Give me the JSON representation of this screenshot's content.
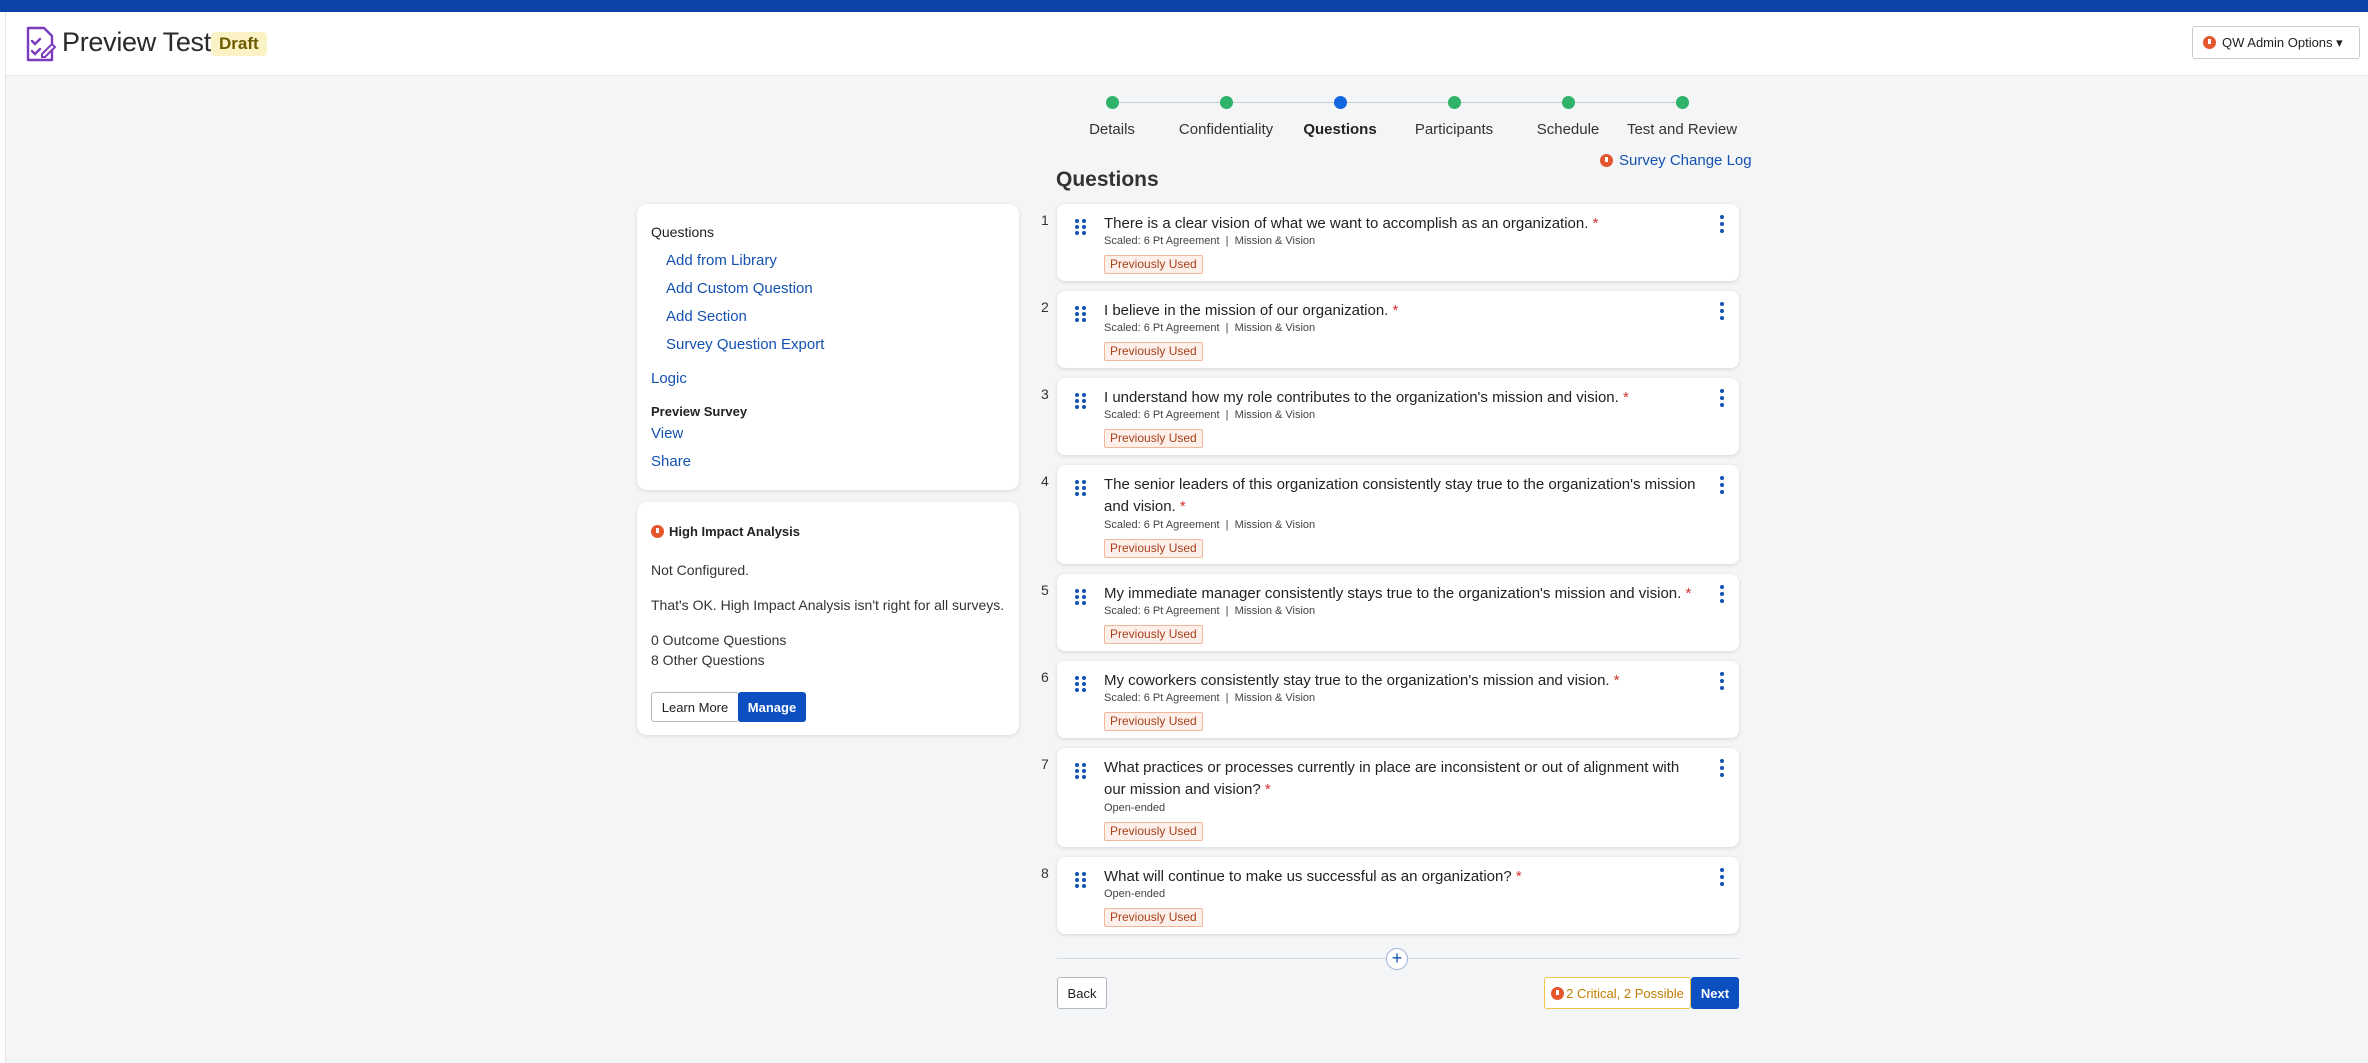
{
  "header": {
    "title": "Preview Test",
    "badge": "Draft",
    "admin_options": "QW Admin Options ▾"
  },
  "stepper": {
    "steps": [
      {
        "label": "Details",
        "state": "complete"
      },
      {
        "label": "Confidentiality",
        "state": "complete"
      },
      {
        "label": "Questions",
        "state": "active"
      },
      {
        "label": "Participants",
        "state": "complete"
      },
      {
        "label": "Schedule",
        "state": "complete"
      },
      {
        "label": "Test and Review",
        "state": "complete"
      }
    ],
    "complete_color": "#2fb36a",
    "active_color": "#1466e0"
  },
  "change_log": "Survey Change Log",
  "main": {
    "heading": "Questions"
  },
  "nav": {
    "heading": "Questions",
    "links": [
      "Add from Library",
      "Add Custom Question",
      "Add Section",
      "Survey Question Export"
    ],
    "logic": "Logic",
    "preview_heading": "Preview Survey",
    "view": "View",
    "share": "Share"
  },
  "hia": {
    "title": "High Impact Analysis",
    "status": "Not Configured.",
    "message": "That's OK. High Impact Analysis isn't right for all surveys.",
    "outcome": "0 Outcome Questions",
    "other": "8 Other Questions",
    "learn_more": "Learn More",
    "manage": "Manage"
  },
  "questions": [
    {
      "num": "1",
      "text": "There is a clear vision of what we want to accomplish as an organization.",
      "meta": "Scaled: 6 Pt Agreement  |  Mission & Vision",
      "badge": "Previously Used"
    },
    {
      "num": "2",
      "text": "I believe in the mission of our organization.",
      "meta": "Scaled: 6 Pt Agreement  |  Mission & Vision",
      "badge": "Previously Used"
    },
    {
      "num": "3",
      "text": "I understand how my role contributes to the organization's mission and vision.",
      "meta": "Scaled: 6 Pt Agreement  |  Mission & Vision",
      "badge": "Previously Used"
    },
    {
      "num": "4",
      "text": "The senior leaders of this organization consistently stay true to the organization's mission and vision.",
      "meta": "Scaled: 6 Pt Agreement  |  Mission & Vision",
      "badge": "Previously Used"
    },
    {
      "num": "5",
      "text": "My immediate manager consistently stays true to the organization's mission and vision.",
      "meta": "Scaled: 6 Pt Agreement  |  Mission & Vision",
      "badge": "Previously Used"
    },
    {
      "num": "6",
      "text": "My coworkers consistently stay true to the organization's mission and vision.",
      "meta": "Scaled: 6 Pt Agreement  |  Mission & Vision",
      "badge": "Previously Used"
    },
    {
      "num": "7",
      "text": "What practices or processes currently in place are inconsistent or out of alignment with our mission and vision?",
      "meta": "Open-ended",
      "badge": "Previously Used"
    },
    {
      "num": "8",
      "text": "What will continue to make us successful as an organization?",
      "meta": "Open-ended",
      "badge": "Previously Used"
    }
  ],
  "required_mark": "*",
  "add_symbol": "+",
  "footer": {
    "back": "Back",
    "issues": "2 Critical, 2 Possible",
    "next": "Next"
  }
}
